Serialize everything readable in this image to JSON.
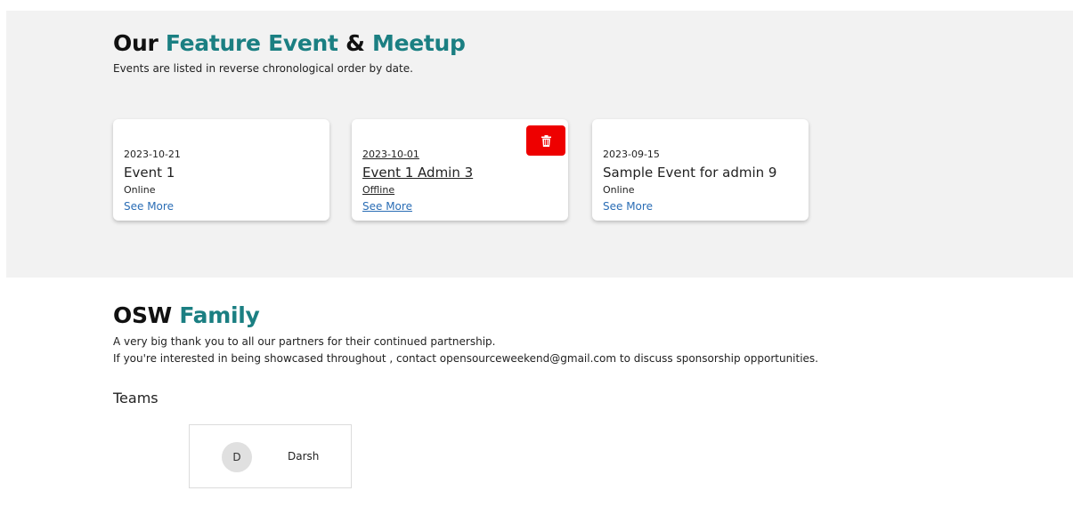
{
  "events_section": {
    "title_part1": "Our ",
    "title_part2": "Feature Event",
    "title_part3": " & ",
    "title_part4": "Meetup",
    "subtitle": "Events are listed in reverse chronological order by date.",
    "events": [
      {
        "date": "2023-10-21",
        "name": "Event 1",
        "mode": "Online",
        "link": "See More"
      },
      {
        "date": "2023-10-01",
        "name": "Event 1 Admin 3",
        "mode": "Offline",
        "link": "See More"
      },
      {
        "date": "2023-09-15",
        "name": "Sample Event for admin 9",
        "mode": "Online",
        "link": "See More"
      }
    ]
  },
  "family_section": {
    "title_part1": "OSW ",
    "title_part2": "Family",
    "line1": "A very big thank you to all our partners for their continued partnership.",
    "line2": "If you're interested in being showcased throughout , contact opensourceweekend@gmail.com to discuss sponsorship opportunities.",
    "teams_label": "Teams",
    "members": [
      {
        "initial": "D",
        "name": "Darsh"
      }
    ]
  },
  "colors": {
    "accent": "#1b7f82",
    "link": "#2a6db5",
    "delete": "#ee0000",
    "section_bg": "#f2f2f2"
  },
  "icons": {
    "delete": "trash-icon"
  }
}
